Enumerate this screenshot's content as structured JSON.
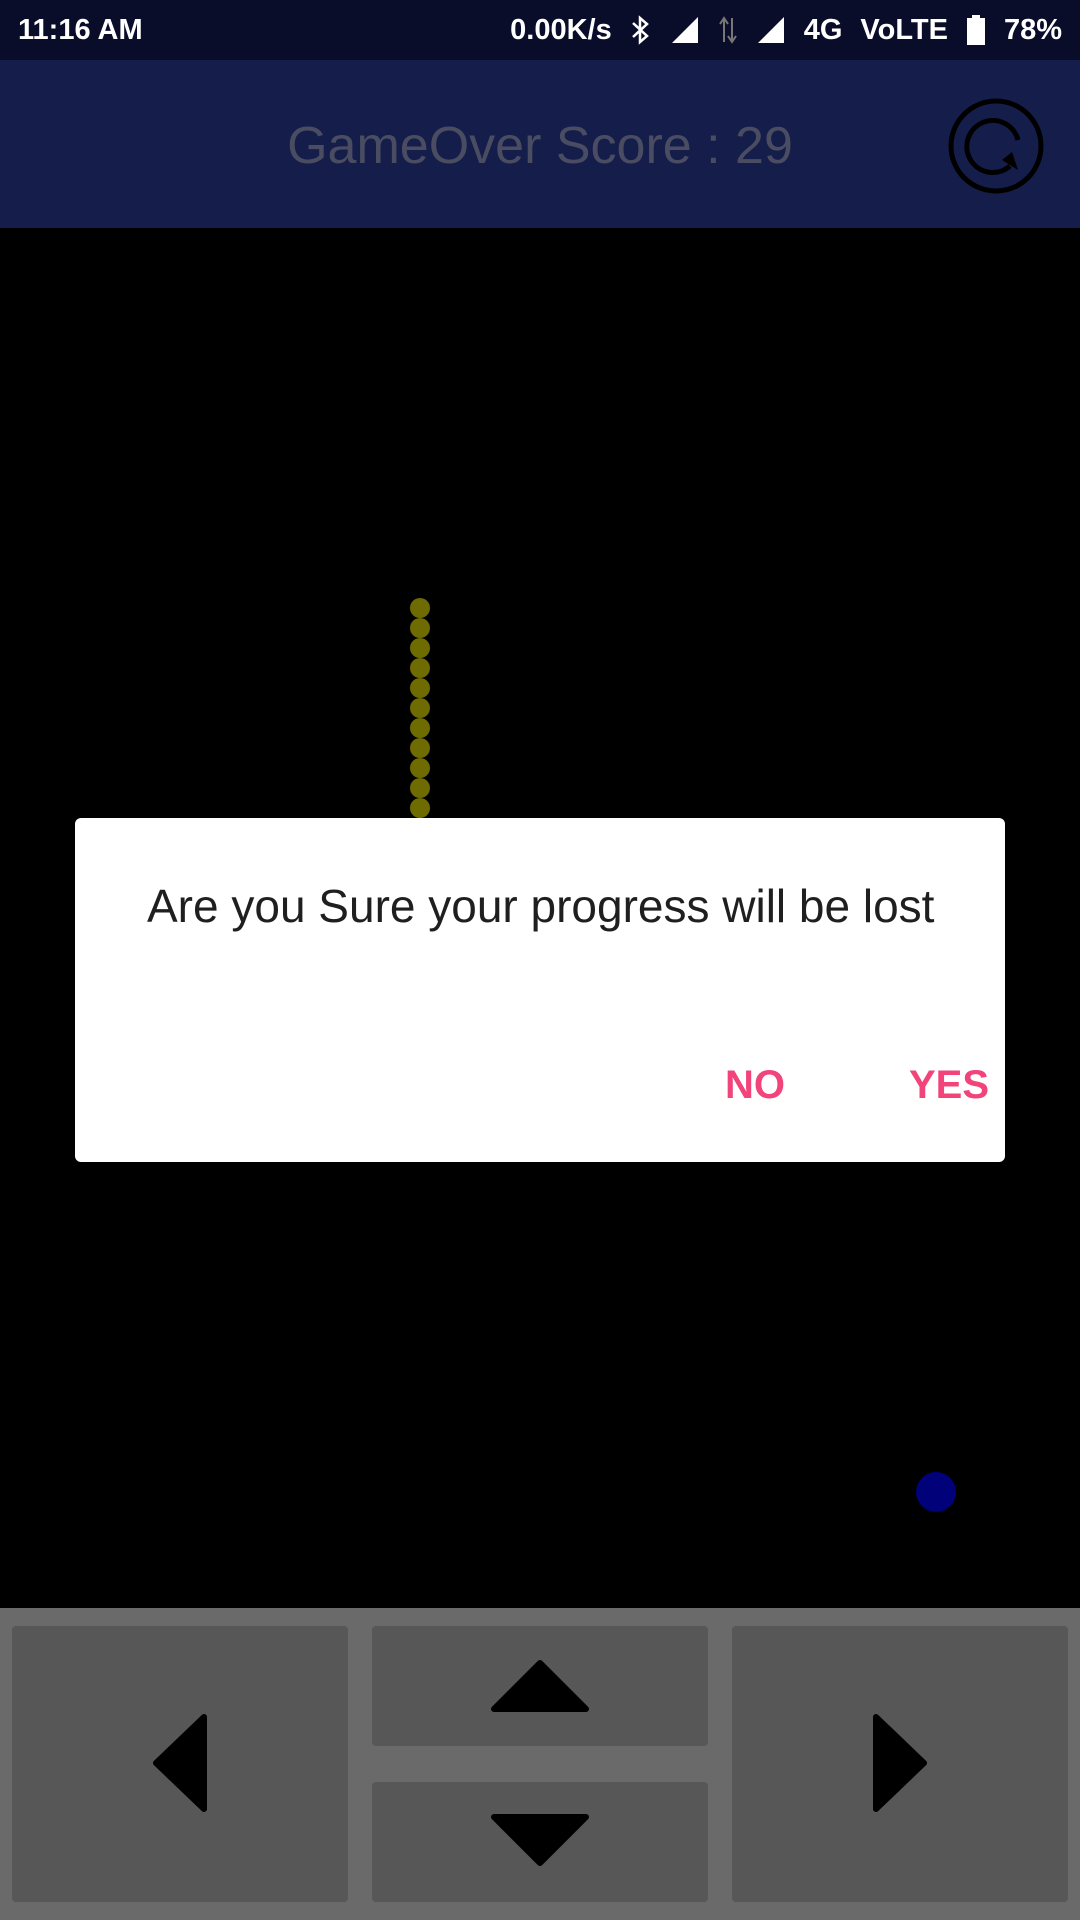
{
  "status_bar": {
    "time": "11:16 AM",
    "net_speed": "0.00K/s",
    "network": "4G",
    "volte": "VoLTE",
    "battery": "78%",
    "icons": [
      "bluetooth-icon",
      "signal-icon",
      "data-arrows-icon",
      "signal-icon",
      "battery-icon"
    ]
  },
  "app_bar": {
    "title": "GameOver Score : 29",
    "refresh_icon": "refresh-icon"
  },
  "game": {
    "snake_segments": 11,
    "snake_color": "#6e6b00",
    "food_color": "#01017a"
  },
  "dialog": {
    "message": "Are you Sure your progress will be lost",
    "no_label": "NO",
    "yes_label": "YES",
    "button_color": "#f2437a"
  },
  "controls": {
    "icons": [
      "arrow-left-icon",
      "arrow-up-icon",
      "arrow-down-icon",
      "arrow-right-icon"
    ]
  }
}
